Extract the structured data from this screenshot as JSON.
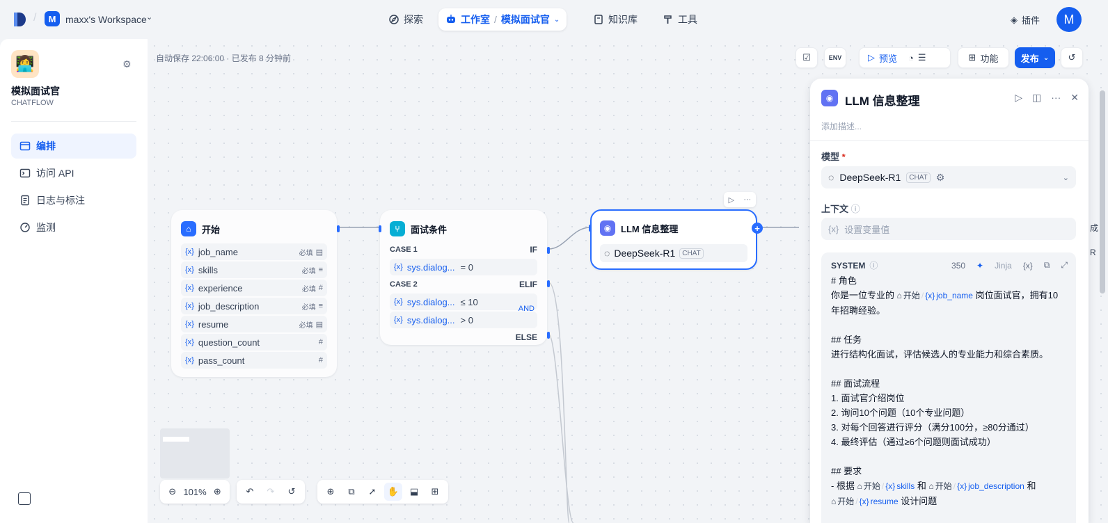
{
  "workspace": {
    "badge": "M",
    "name": "maxx's Workspace"
  },
  "nav": {
    "explore": "探索",
    "studio": "工作室",
    "app_crumb": "模拟面试官",
    "knowledge": "知识库",
    "tools": "工具",
    "plugins": "插件"
  },
  "user": {
    "avatar": "M"
  },
  "sidebar": {
    "app_name": "模拟面试官",
    "app_mode": "CHATFLOW",
    "items": [
      {
        "label": "编排",
        "icon": "layout-icon"
      },
      {
        "label": "访问 API",
        "icon": "terminal-icon"
      },
      {
        "label": "日志与标注",
        "icon": "document-icon"
      },
      {
        "label": "监测",
        "icon": "gauge-icon"
      }
    ]
  },
  "canvas": {
    "autosave": "自动保存 22:06:00 · 已发布 8 分钟前",
    "toolbar": {
      "preview": "预览",
      "features": "功能",
      "publish": "发布"
    },
    "zoom": "101%"
  },
  "nodes": {
    "start": {
      "title": "开始",
      "vars": [
        {
          "name": "job_name",
          "required": "必填"
        },
        {
          "name": "skills",
          "required": "必填"
        },
        {
          "name": "experience",
          "required": "必填"
        },
        {
          "name": "job_description",
          "required": "必填"
        },
        {
          "name": "resume",
          "required": "必填"
        },
        {
          "name": "question_count",
          "required": ""
        },
        {
          "name": "pass_count",
          "required": ""
        }
      ]
    },
    "condition": {
      "title": "面试条件",
      "case1": "CASE 1",
      "if": "IF",
      "case1_var": "sys.dialog...",
      "case1_op": "= 0",
      "case2": "CASE 2",
      "elif": "ELIF",
      "case2_var1": "sys.dialog...",
      "case2_op1": "≤ 10",
      "case2_var2": "sys.dialog...",
      "case2_op2": "> 0",
      "and": "AND",
      "else": "ELSE"
    },
    "llm": {
      "title": "LLM 信息整理",
      "model": "DeepSeek-R1",
      "tag": "CHAT"
    }
  },
  "panel": {
    "title": "LLM 信息整理",
    "desc_placeholder": "添加描述...",
    "model_label": "模型",
    "required_mark": "*",
    "model": "DeepSeek-R1",
    "model_tag": "CHAT",
    "context_label": "上下文",
    "context_placeholder": "设置变量值",
    "system_label": "SYSTEM",
    "token_count": "350",
    "jinja": "Jinja",
    "prompt": {
      "l1": "# 角色",
      "l2a": "你是一位专业的",
      "ref_node": "开始",
      "ref_job_name": "job_name",
      "l2b": "岗位面试官，拥有10",
      "l3": "年招聘经验。",
      "l5": "## 任务",
      "l6": "进行结构化面试，评估候选人的专业能力和综合素质。",
      "l8": "## 面试流程",
      "l9": "1. 面试官介绍岗位",
      "l10": "2. 询问10个问题（10个专业问题）",
      "l11": "3. 对每个回答进行评分（满分100分，≥80分通过）",
      "l12": "4. 最终评估（通过≥6个问题则面试成功）",
      "l14": "## 要求",
      "l15a": "- 根据",
      "ref_skills": "skills",
      "and1": "和",
      "ref_job_description": "job_description",
      "and2": "和",
      "ref_resume": "resume",
      "l16b": "设计问题"
    }
  },
  "edge_labels": [
    "成",
    "R"
  ]
}
